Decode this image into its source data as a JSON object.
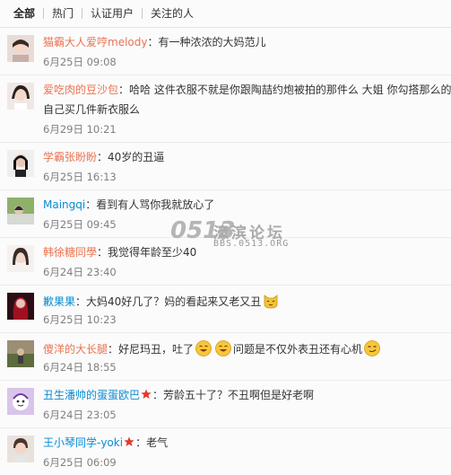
{
  "tabs": [
    "全部",
    "热门",
    "认证用户",
    "关注的人"
  ],
  "watermark": {
    "logo": "0513",
    "name": "濠滨论坛",
    "url": "BBS.0513.ORG"
  },
  "colors": {
    "username": "#eb7350",
    "username_blue": "#0a8cd2",
    "time": "#808080"
  },
  "comments": [
    {
      "user": "猫霸大人爱哼melody",
      "sep": "：",
      "text": "有一种浓浓的大妈范儿",
      "time": "6月25日 09:08"
    },
    {
      "user": "爱吃肉的豆沙包",
      "sep": "：",
      "text": "哈哈 这件衣服不就是你跟陶喆约炮被拍的那件么 大姐 你勾搭那么的",
      "text2": "自己买几件新衣服么",
      "time": "6月29日 10:21"
    },
    {
      "user": "学霸张盼盼",
      "sep": "：",
      "text": "40岁的丑逼",
      "time": "6月25日 16:13"
    },
    {
      "user": "Maingqi",
      "sep": "：",
      "text": "看到有人骂你我就放心了",
      "time": "6月25日 09:45"
    },
    {
      "user": "韩徐糖同學",
      "sep": "：",
      "text": "我觉得年龄至少40",
      "time": "6月24日 23:40"
    },
    {
      "user": "歉果果",
      "sep": "：",
      "text": "大妈40好几了？妈的看起来又老又丑",
      "emoji": "cat-face-icon",
      "time": "6月25日 10:23"
    },
    {
      "user": "傻洋的大长腿",
      "sep": "：",
      "text": "好尼玛丑，吐了",
      "text_mid": "问题是不仅外表丑还有心机",
      "emoji": "laughing-face-icon",
      "time": "6月24日 18:55"
    },
    {
      "user": "丑生潘帅的蛋蛋欧巴",
      "sep": "：",
      "text": "芳龄五十了？不丑啊但是好老啊",
      "badge": "star-badge-icon",
      "time": "6月24日 23:05"
    },
    {
      "user": "王小琴同学-yoki",
      "sep": "：",
      "text": "老气",
      "badge": "star-badge-icon",
      "time": "6月25日 06:09"
    }
  ]
}
